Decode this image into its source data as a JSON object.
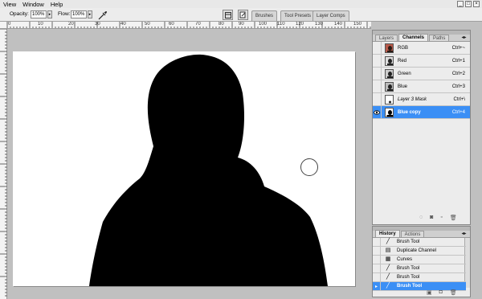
{
  "menubar": {
    "items": [
      "View",
      "Window",
      "Help"
    ]
  },
  "options": {
    "opacity_label": "Opacity:",
    "opacity_value": "100%",
    "flow_label": "Flow:",
    "flow_value": "100%",
    "well_tabs": [
      "Brushes",
      "Tool Presets",
      "Layer Comps"
    ]
  },
  "ruler": {
    "h_labels": [
      "0",
      "10",
      "20",
      "30",
      "40",
      "50",
      "60",
      "70",
      "80",
      "90",
      "100",
      "110",
      "120",
      "130",
      "140",
      "150"
    ]
  },
  "channels_panel": {
    "tabs": [
      "Layers",
      "Channels",
      "Paths"
    ],
    "rows": [
      {
        "name": "RGB",
        "shortcut": "Ctrl+~"
      },
      {
        "name": "Red",
        "shortcut": "Ctrl+1"
      },
      {
        "name": "Green",
        "shortcut": "Ctrl+2"
      },
      {
        "name": "Blue",
        "shortcut": "Ctrl+3"
      },
      {
        "name": "Layer 3 Mask",
        "shortcut": "Ctrl+\\"
      },
      {
        "name": "Blue copy",
        "shortcut": "Ctrl+4"
      }
    ]
  },
  "history_panel": {
    "tabs": [
      "History",
      "Actions"
    ],
    "rows": [
      {
        "name": "Brush Tool"
      },
      {
        "name": "Duplicate Channel"
      },
      {
        "name": "Curves"
      },
      {
        "name": "Brush Tool"
      },
      {
        "name": "Brush Tool"
      },
      {
        "name": "Brush Tool"
      }
    ]
  },
  "colors": {
    "selection": "#3b8ff5",
    "silhouette": "#000000",
    "workspace": "#c0c0c0"
  }
}
